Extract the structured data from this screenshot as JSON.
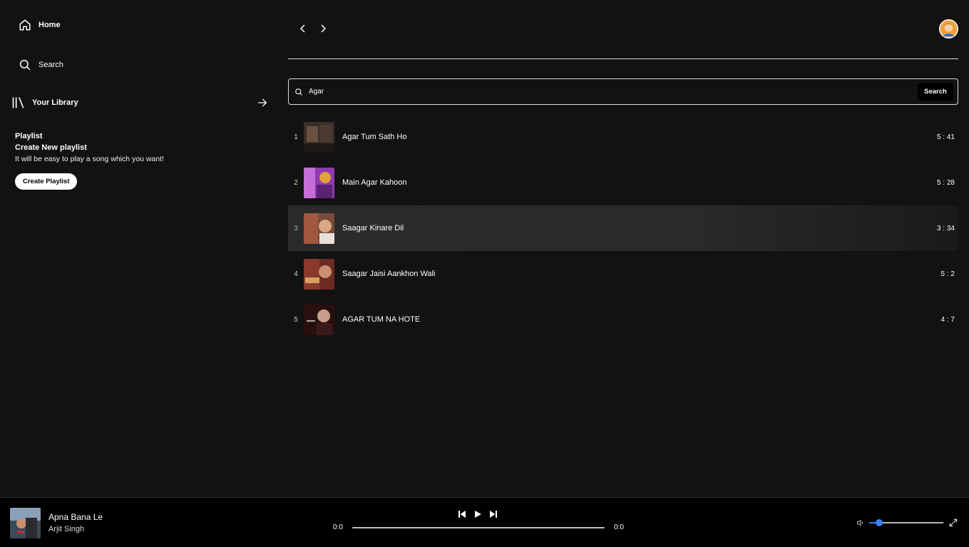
{
  "sidebar": {
    "home_label": "Home",
    "search_label": "Search",
    "library_label": "Your Library",
    "playlist": {
      "title": "Playlist",
      "subtitle": "Create New playlist",
      "description": "It will be easy to play a song which you want!",
      "button_label": "Create Playlist"
    }
  },
  "search": {
    "value": "Agar",
    "button_label": "Search"
  },
  "tracks": [
    {
      "num": "1",
      "name": "Agar Tum Sath Ho",
      "duration": "5 : 41",
      "thumb_color": "#3a2e28"
    },
    {
      "num": "2",
      "name": "Main Agar Kahoon",
      "duration": "5 : 28",
      "thumb_color": "#8e3bb0"
    },
    {
      "num": "3",
      "name": "Saagar Kinare Dil",
      "duration": "3 : 34",
      "thumb_color": "#7a4a3a"
    },
    {
      "num": "4",
      "name": "Saagar Jaisi Aankhon Wali",
      "duration": "5 : 2",
      "thumb_color": "#6b2a22"
    },
    {
      "num": "5",
      "name": "AGAR TUM NA HOTE",
      "duration": "4 : 7",
      "thumb_color": "#2a0f0f"
    }
  ],
  "player": {
    "title": "Apna Bana Le",
    "artist": "Arjit Singh",
    "time_current": "0:0",
    "time_total": "0:0",
    "progress": 0,
    "volume": 0.13,
    "accent": "#3b82f6"
  }
}
